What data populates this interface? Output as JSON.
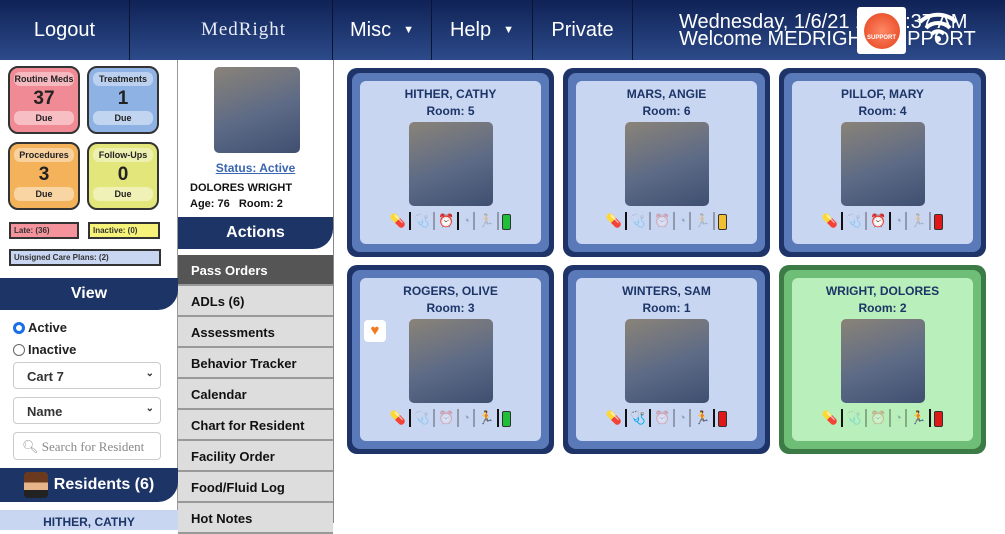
{
  "header": {
    "logout": "Logout",
    "logo": "MedRight",
    "misc": "Misc",
    "help": "Help",
    "private": "Private",
    "datetime": "Wednesday, 1/6/21 10:19:37 AM",
    "welcome": "Welcome MEDRIGHT SUPPORT",
    "support_label": "SUPPORT"
  },
  "tiles": [
    {
      "title": "Routine Meds",
      "count": "37",
      "due": "Due",
      "color": "#f08a94"
    },
    {
      "title": "Treatments",
      "count": "1",
      "due": "Due",
      "color": "#8fb2e4"
    },
    {
      "title": "Procedures",
      "count": "3",
      "due": "Due",
      "color": "#f4b35a"
    },
    {
      "title": "Follow-Ups",
      "count": "0",
      "due": "Due",
      "color": "#e3e67a"
    }
  ],
  "badges": {
    "late": "Late: (36)",
    "inactive": "Inactive: (0)",
    "unsigned": "Unsigned Care Plans: (2)"
  },
  "view": {
    "title": "View",
    "active": "Active",
    "inactive": "Inactive",
    "cart": "Cart 7",
    "sort": "Name",
    "search_placeholder": "Search for Resident"
  },
  "residents": {
    "title": "Residents (6)",
    "first": "HITHER, CATHY"
  },
  "profile": {
    "status": "Status: Active",
    "name": "DOLORES WRIGHT",
    "age": "Age: 76",
    "room": "Room: 2"
  },
  "actions": {
    "title": "Actions",
    "items": [
      "Pass Orders",
      "ADLs (6)",
      "Assessments",
      "Behavior Tracker",
      "Calendar",
      "Chart for Resident",
      "Facility Order",
      "Food/Fluid Log",
      "Hot Notes"
    ]
  },
  "cards": [
    {
      "name": "HITHER, CATHY",
      "room": "Room: 5",
      "status": "#1fbf3a",
      "icons": [
        1,
        0,
        1,
        0,
        0
      ]
    },
    {
      "name": "MARS, ANGIE",
      "room": "Room: 6",
      "status": "#f0c030",
      "icons": [
        1,
        0,
        0,
        0,
        0
      ]
    },
    {
      "name": "PILLOF, MARY",
      "room": "Room: 4",
      "status": "#e01818",
      "icons": [
        1,
        0,
        1,
        0,
        0
      ]
    },
    {
      "name": "ROGERS, OLIVE",
      "room": "Room: 3",
      "status": "#1fbf3a",
      "icons": [
        1,
        0,
        0,
        0,
        1
      ]
    },
    {
      "name": "WINTERS, SAM",
      "room": "Room: 1",
      "status": "#e01818",
      "icons": [
        1,
        1,
        0,
        0,
        1
      ]
    },
    {
      "name": "WRIGHT, DOLORES",
      "room": "Room: 2",
      "status": "#e01818",
      "icons": [
        1,
        0,
        0,
        0,
        1
      ]
    }
  ]
}
